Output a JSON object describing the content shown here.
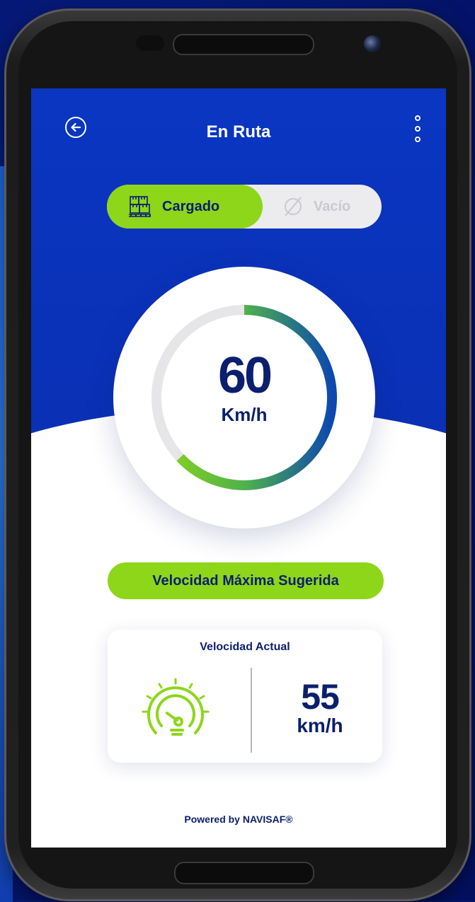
{
  "header": {
    "title": "En Ruta"
  },
  "toggle": {
    "options": [
      {
        "label": "Cargado",
        "icon": "cargo-boxes-icon",
        "active": true
      },
      {
        "label": "Vacío",
        "icon": "empty-set-icon",
        "active": false
      }
    ]
  },
  "speed_limit": {
    "value": "60",
    "unit": "Km/h",
    "gauge_fraction": 0.63
  },
  "suggested_label": "Velocidad Máxima Sugerida",
  "current_speed": {
    "title": "Velocidad Actual",
    "value": "55",
    "unit": "km/h",
    "icon": "speedometer-icon"
  },
  "footer": {
    "text": "Powered by NAVISAF®"
  },
  "colors": {
    "primary_blue": "#0a36c2",
    "accent_green": "#8ed61a",
    "text_navy": "#0b1f6e"
  }
}
